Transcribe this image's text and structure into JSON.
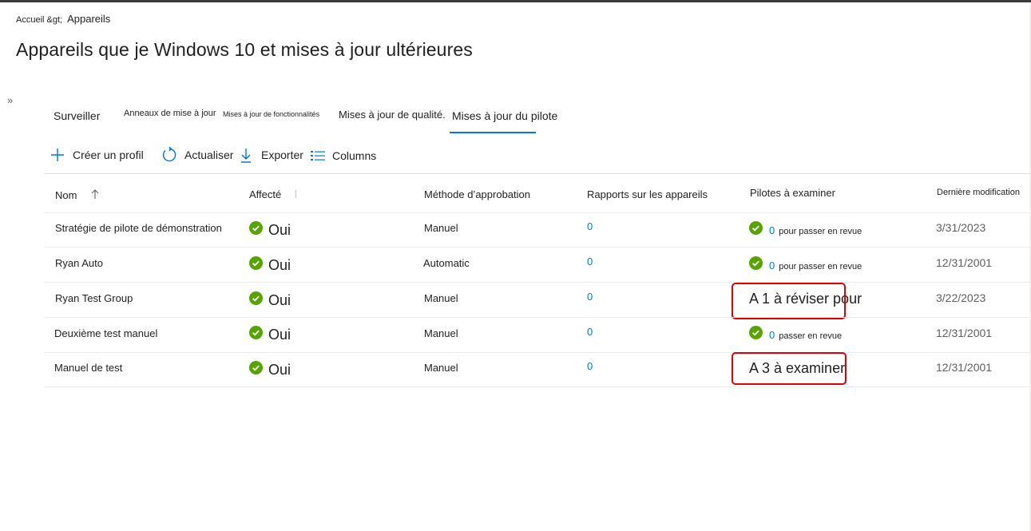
{
  "breadcrumb": {
    "home": "Accueil &gt;",
    "current": "Appareils"
  },
  "page": {
    "title": "Appareils que je Windows 10 et mises à jour ultérieures"
  },
  "tabs": [
    {
      "label": "Surveiller"
    },
    {
      "label": "Anneaux de mise à jour"
    },
    {
      "label": "Mises à jour de fonctionnalités"
    },
    {
      "label": "Mises à jour de qualité."
    },
    {
      "label": "Mises à jour du pilote",
      "selected": true
    }
  ],
  "toolbar": {
    "create_label": "Créer un profil",
    "refresh_label": "Actualiser",
    "export_label": "Exporter",
    "columns_label": "Columns"
  },
  "table": {
    "headers": {
      "name": "Nom",
      "assigned": "Affecté",
      "approval": "Méthode d’approbation",
      "reports": "Rapports sur les appareils",
      "drivers": "Pilotes à examiner",
      "modified": "Dernière modification"
    },
    "sort_column": "name",
    "sort_direction": "ascending",
    "rows": [
      {
        "name": "Stratégie de pilote de démonstration",
        "assigned": "Oui",
        "approval": "Manuel",
        "reports": "0",
        "drivers_count": "0",
        "drivers_suffix": "pour passer en revue",
        "annotation": "",
        "modified": "3/31/2023"
      },
      {
        "name": "Ryan Auto",
        "assigned": "Oui",
        "approval": "Automatic",
        "reports": "0",
        "drivers_count": "0",
        "drivers_suffix": "pour passer en revue",
        "annotation": "",
        "modified": "12/31/2001"
      },
      {
        "name": "Ryan Test Group",
        "assigned": "Oui",
        "approval": "Manuel",
        "reports": "0",
        "drivers_count": "",
        "drivers_suffix": "",
        "annotation": "A 1 à réviser pour",
        "modified": "3/22/2023"
      },
      {
        "name": "Deuxième test manuel",
        "assigned": "Oui",
        "approval": "Manuel",
        "reports": "0",
        "drivers_count": "0",
        "drivers_suffix": "passer en revue",
        "annotation": "",
        "modified": "12/31/2001"
      },
      {
        "name": "Manuel de test",
        "assigned": "Oui",
        "approval": "Manuel",
        "reports": "0",
        "drivers_count": "",
        "drivers_suffix": "",
        "annotation": "A 3 à examiner",
        "modified": "12/31/2001"
      }
    ]
  },
  "colors": {
    "accent": "#0078d4",
    "success": "#57a300",
    "highlight": "#e00000",
    "text": "#201f1e"
  },
  "icons": {
    "expand": "chevron-double-right-icon",
    "create": "plus-icon",
    "refresh": "refresh-icon",
    "export": "download-icon",
    "columns": "list-icon",
    "sort": "arrow-up-icon",
    "status": "checkmark-circle-icon"
  }
}
